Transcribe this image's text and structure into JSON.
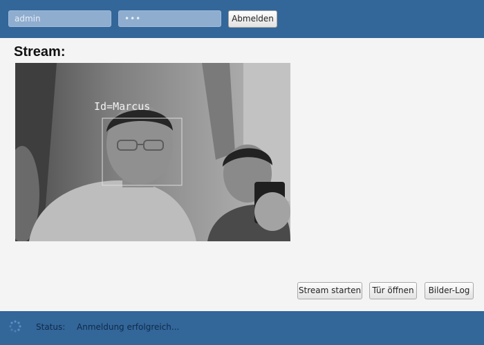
{
  "login": {
    "username_value": "admin",
    "password_value": "•••",
    "logout_label": "Abmelden"
  },
  "stream": {
    "title": "Stream:",
    "overlay_label": "Id=Marcus"
  },
  "actions": {
    "start_stream_label": "Stream starten",
    "open_door_label": "Tür öffnen",
    "image_log_label": "Bilder-Log"
  },
  "status": {
    "label": "Status:",
    "text": "Anmeldung erfolgreich..."
  },
  "colors": {
    "bar_background": "#336699",
    "content_background": "#f4f4f4"
  },
  "icons": {
    "spinner": "loading-spinner-icon"
  }
}
